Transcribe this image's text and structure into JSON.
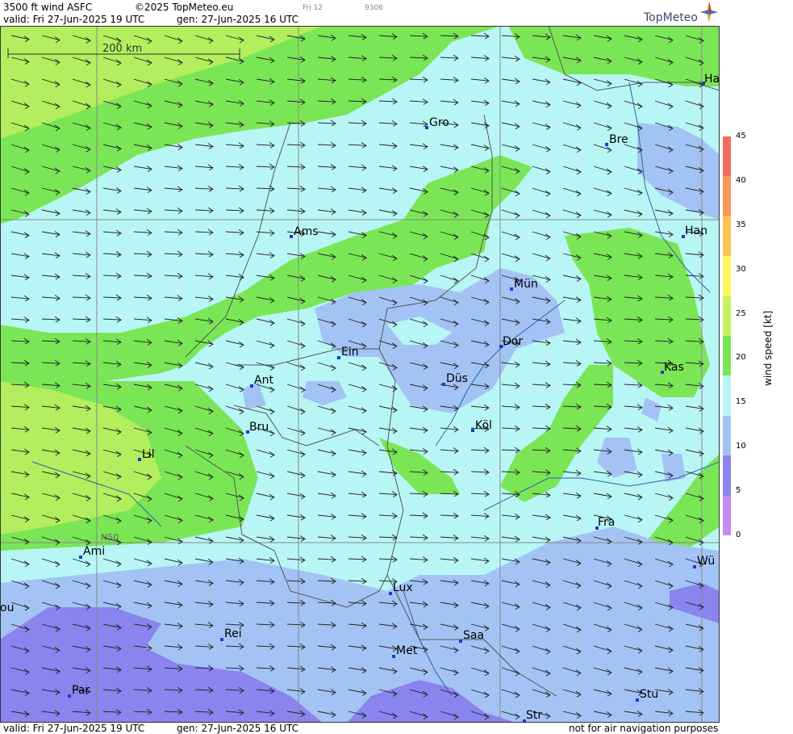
{
  "header": {
    "product": "3500 ft wind ASFC",
    "copyright": "©2025 TopMeteo.eu",
    "day_label": "Fri 12",
    "code": "9306",
    "valid": "valid:  Fri  27-Jun-2025  19 UTC",
    "gen": "gen: 27-Jun-2025 16 UTC",
    "brand": "TopMeteo"
  },
  "scale_bar": {
    "label": "200 km"
  },
  "grid_label": "N50",
  "cities": [
    "Ha",
    "Gro",
    "Bre",
    "Ams",
    "Han",
    "Mün",
    "Ein",
    "Dor",
    "Kas",
    "Ant",
    "Düs",
    "Köl",
    "Bru",
    "Lil",
    "Fra",
    "Ami",
    "Wü",
    "Lux",
    "ou",
    "Rei",
    "Saa",
    "Met",
    "Par",
    "Stu",
    "Str"
  ],
  "colorbar": {
    "title": "wind  speed  [kt]",
    "ticks": [
      "45",
      "40",
      "35",
      "30",
      "25",
      "20",
      "15",
      "10",
      "5",
      "0"
    ],
    "colors": [
      "#f06c5c",
      "#f79a58",
      "#fcc653",
      "#fdf85a",
      "#c8f060",
      "#7ae656",
      "#b8f6f6",
      "#a3c3f5",
      "#8a84ee",
      "#c48cee"
    ]
  },
  "footer": {
    "valid": "valid:  Fri  27-Jun-2025  19 UTC",
    "gen": "gen: 27-Jun-2025 16 UTC",
    "note": "not for air navigation purposes"
  }
}
